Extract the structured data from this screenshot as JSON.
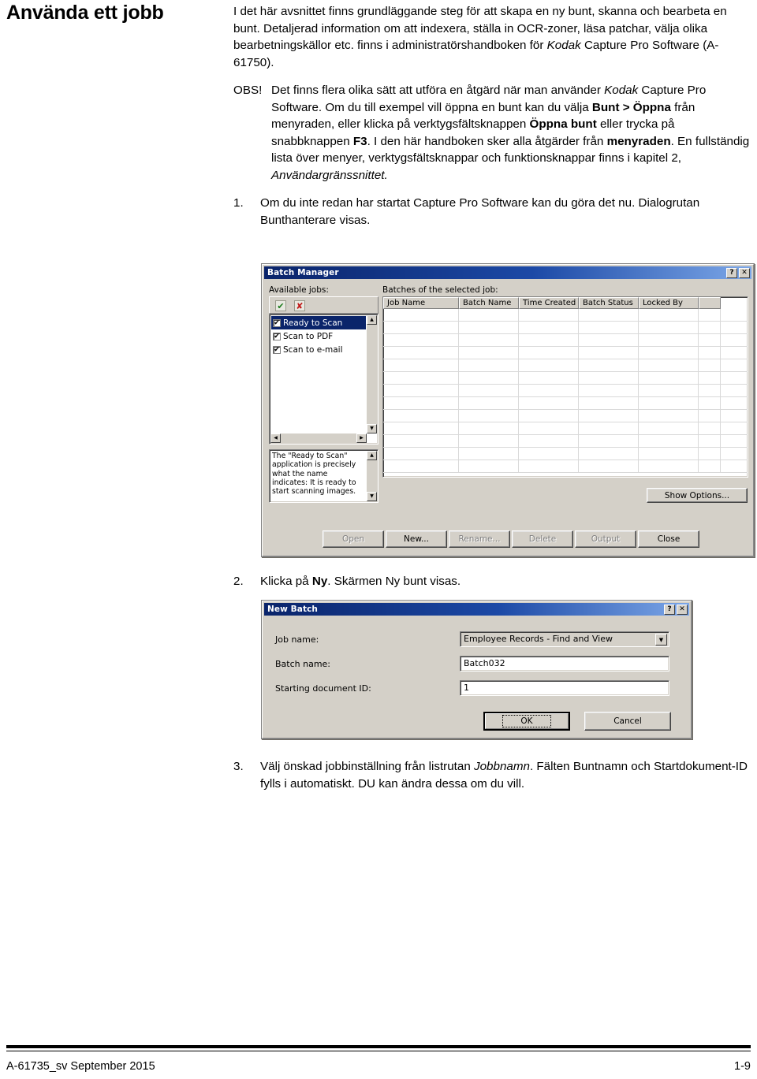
{
  "document": {
    "section_title": "Använda ett jobb",
    "footer_left": "A-61735_sv  September 2015",
    "footer_right": "1-9"
  },
  "body": {
    "intro": "I det här avsnittet finns grundläggande steg för att skapa en ny bunt, skanna och bearbeta en bunt. Detaljerad information om att indexera, ställa in OCR-zoner, läsa patchar, välja olika bearbetningskällor etc. finns i administratörshandboken för ",
    "intro_italic": "Kodak",
    "intro_tail": " Capture Pro Software (A-61750).",
    "note_label": "OBS!",
    "note_p1": "Det finns flera olika sätt att utföra en åtgärd när man använder ",
    "note_kodak": "Kodak",
    "note_p2": " Capture Pro Software. Om du till exempel vill öppna en bunt kan du välja ",
    "note_bold1": "Bunt > Öppna",
    "note_p3": " från menyraden, eller klicka på verktygsfältsknappen ",
    "note_bold2": "Öppna bunt",
    "note_p4": " eller trycka på snabbknappen ",
    "note_bold3": "F3",
    "note_p5": ". I den här handboken sker alla åtgärder från ",
    "note_bold4": "menyraden",
    "note_p6": ". En fullständig lista över menyer, verktygsfältsknappar och funktionsknappar finns i kapitel 2, ",
    "note_italic2": "Användargränssnittet."
  },
  "steps": {
    "step1_num": "1.",
    "step1_text": "Om du inte redan har startat Capture Pro Software kan du göra det nu. Dialogrutan Bunthanterare visas.",
    "step2_num": "2.",
    "step2_pre": "Klicka på ",
    "step2_bold": "Ny",
    "step2_post": ". Skärmen Ny bunt visas.",
    "step3_num": "3.",
    "step3_pre": "Välj önskad jobbinställning från listrutan ",
    "step3_italic": "Jobbnamn",
    "step3_post": ". Fälten Buntnamn och Startdokument-ID fylls i automatiskt. DU kan ändra dessa om du vill."
  },
  "batch_manager": {
    "title": "Batch Manager",
    "help_btn": "?",
    "close_btn": "✕",
    "available_jobs_label": "Available jobs:",
    "batches_label": "Batches of the selected job:",
    "toolbar": {
      "enable_icon": "✔",
      "disable_icon": "✘"
    },
    "jobs": [
      {
        "label": "Ready to Scan",
        "checked": "✔",
        "selected": true
      },
      {
        "label": "Scan to PDF",
        "checked": "✔",
        "selected": false
      },
      {
        "label": "Scan to e-mail",
        "checked": "✔",
        "selected": false
      }
    ],
    "description": "The \"Ready to Scan\" application is precisely what the name indicates: It is ready to start scanning images.",
    "columns": [
      "Job Name",
      "Batch Name",
      "Time Created",
      "Batch Status",
      "Locked By",
      ""
    ],
    "rows": [],
    "show_options_label": "Show Options...",
    "buttons": [
      {
        "label": "Open",
        "enabled": false
      },
      {
        "label": "New...",
        "enabled": true
      },
      {
        "label": "Rename...",
        "enabled": false
      },
      {
        "label": "Delete",
        "enabled": false
      },
      {
        "label": "Output",
        "enabled": false
      },
      {
        "label": "Close",
        "enabled": true
      }
    ]
  },
  "new_batch": {
    "title": "New Batch",
    "help_btn": "?",
    "close_btn": "✕",
    "job_name_label": "Job name:",
    "job_name_value": "Employee Records - Find and View",
    "batch_name_label": "Batch name:",
    "batch_name_value": "Batch032",
    "starting_doc_label": "Starting document ID:",
    "starting_doc_value": "1",
    "dropdown_icon": "▼",
    "ok_label": "OK",
    "cancel_label": "Cancel"
  },
  "colors": {
    "dialog_face": "#d4d0c8",
    "title_active": "#0a246a",
    "selection": "#0a246a",
    "field_bg": "#ffffff"
  }
}
